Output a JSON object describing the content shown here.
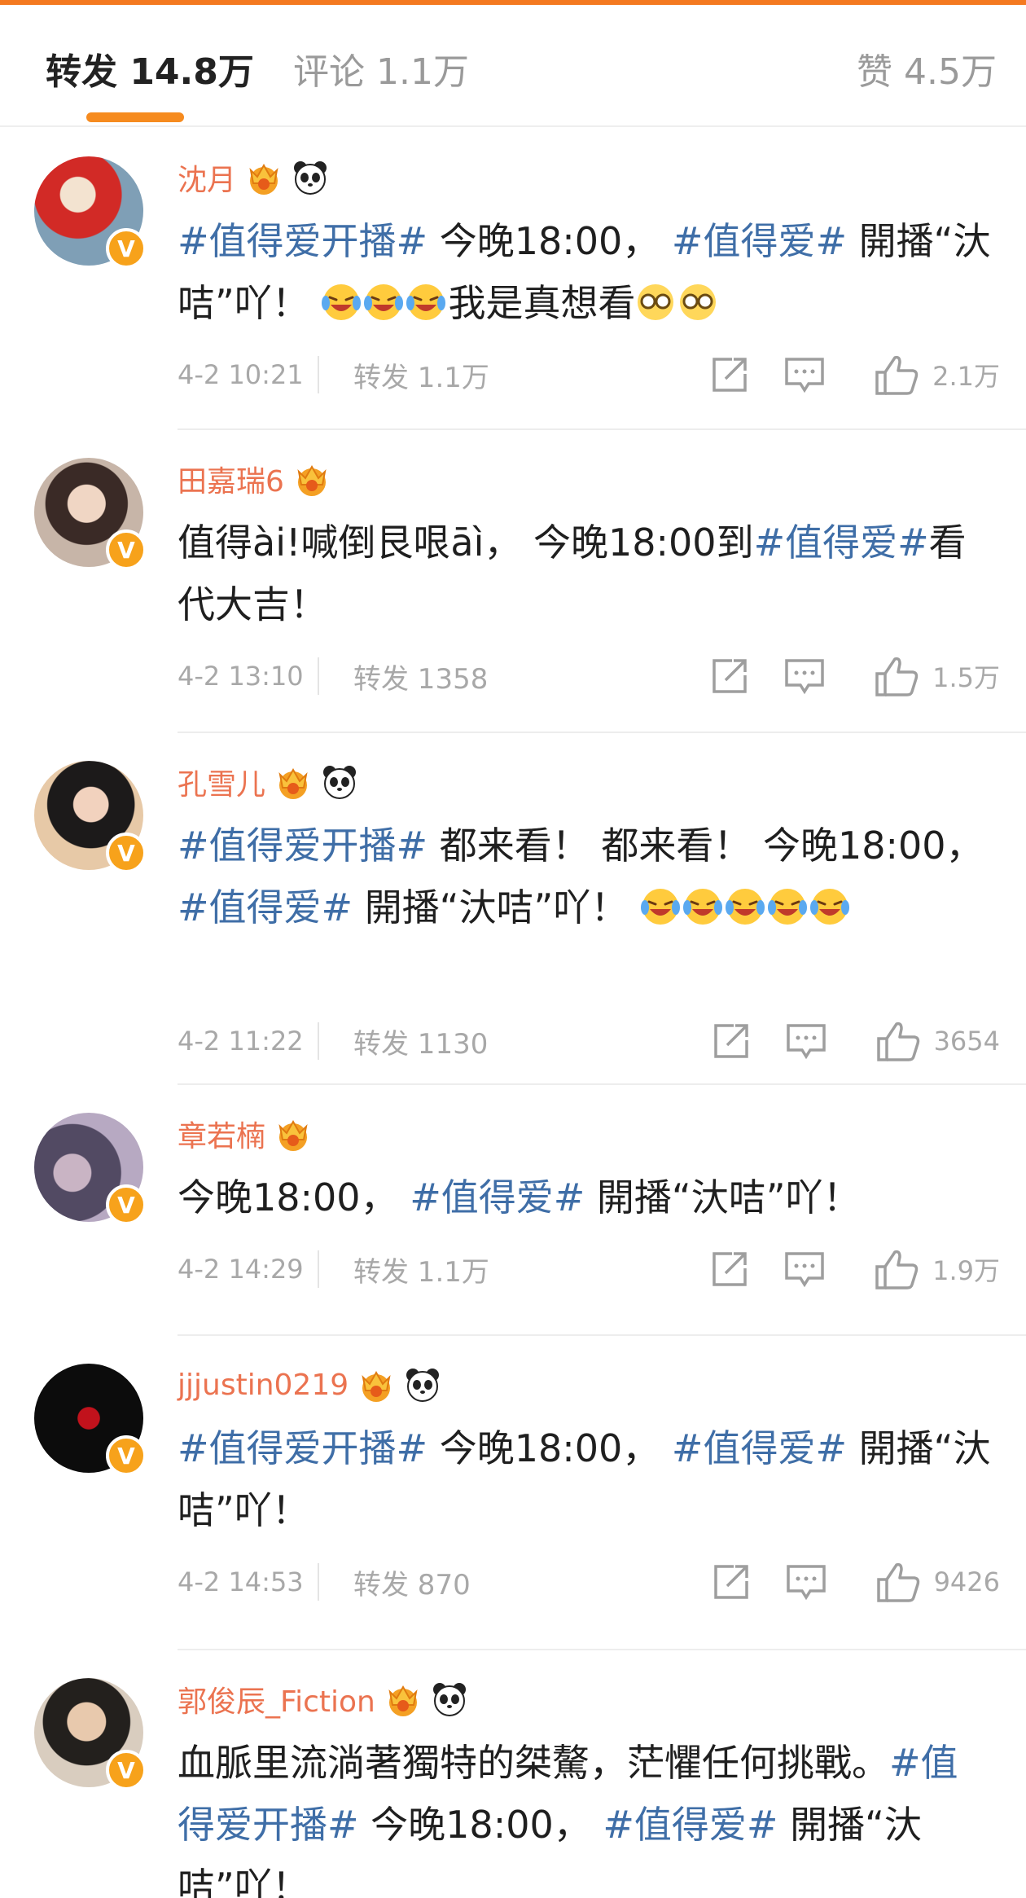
{
  "tabs": {
    "repost": "转发 14.8万",
    "comment": "评论 1.1万",
    "like": "赞 4.5万"
  },
  "colors": {
    "accent": "#f68b1f",
    "username": "#eb7350",
    "hashtag": "#3f6ea7",
    "meta_text": "#a8a8a8"
  },
  "posts": [
    {
      "username": "沈月",
      "icons": [
        "crown-icon",
        "panda-icon"
      ],
      "segments": [
        {
          "t": "#值得爱开播#",
          "tag": true
        },
        {
          "t": " 今晚18:00， "
        },
        {
          "t": "#值得爱#",
          "tag": true
        },
        {
          "t": " 開播“汏咭”吖！ "
        },
        {
          "t": "[哭笑][哭笑][哭笑]",
          "emoji": "laugh-cry-emoji",
          "count": 3
        },
        {
          "t": "我是真想看"
        },
        {
          "t": "[眼镜][眼镜]",
          "emoji": "glasses-emoji",
          "count": 2
        }
      ],
      "time": "4-2 10:21",
      "repost": "转发 1.1万",
      "likes": "2.1万"
    },
    {
      "username": "田嘉瑞6",
      "icons": [
        "crown-icon"
      ],
      "segments": [
        {
          "t": "值得ài!喊倒艮哏āì， 今晚18:00到"
        },
        {
          "t": "#值得爱#",
          "tag": true
        },
        {
          "t": "看代大吉！"
        }
      ],
      "time": "4-2 13:10",
      "repost": "转发 1358",
      "likes": "1.5万"
    },
    {
      "username": "孔雪儿",
      "icons": [
        "crown-icon",
        "panda-icon"
      ],
      "segments": [
        {
          "t": "#值得爱开播#",
          "tag": true
        },
        {
          "t": " 都来看！ 都来看！ 今晚18:00， "
        },
        {
          "t": "#值得爱#",
          "tag": true
        },
        {
          "t": " 開播“汏咭”吖！ "
        },
        {
          "t": "[哭笑][哭笑][哭笑][哭笑][哭笑]",
          "emoji": "laugh-cry-emoji",
          "count": 5
        }
      ],
      "time": "4-2 11:22",
      "repost": "转发 1130",
      "likes": "3654"
    },
    {
      "username": "章若楠",
      "icons": [
        "crown-icon"
      ],
      "segments": [
        {
          "t": "今晚18:00， "
        },
        {
          "t": "#值得爱#",
          "tag": true
        },
        {
          "t": " 開播“汏咭”吖！"
        }
      ],
      "time": "4-2 14:29",
      "repost": "转发 1.1万",
      "likes": "1.9万"
    },
    {
      "username": "jjjustin0219",
      "icons": [
        "crown-icon",
        "panda-icon"
      ],
      "segments": [
        {
          "t": "#值得爱开播#",
          "tag": true
        },
        {
          "t": " 今晚18:00， "
        },
        {
          "t": "#值得爱#",
          "tag": true
        },
        {
          "t": " 開播“汏咭”吖！"
        }
      ],
      "time": "4-2 14:53",
      "repost": "转发 870",
      "likes": "9426"
    },
    {
      "username": "郭俊辰_Fiction",
      "icons": [
        "crown-icon",
        "panda-icon"
      ],
      "segments": [
        {
          "t": "血脈里流淌著獨特的桀驁，茫懼任何挑戰。"
        },
        {
          "t": "#值得爱开播#",
          "tag": true
        },
        {
          "t": " 今晚18:00， "
        },
        {
          "t": "#值得爱#",
          "tag": true
        },
        {
          "t": " 開播“汏咭”吖！"
        }
      ],
      "time": "",
      "repost": "",
      "likes": ""
    }
  ]
}
